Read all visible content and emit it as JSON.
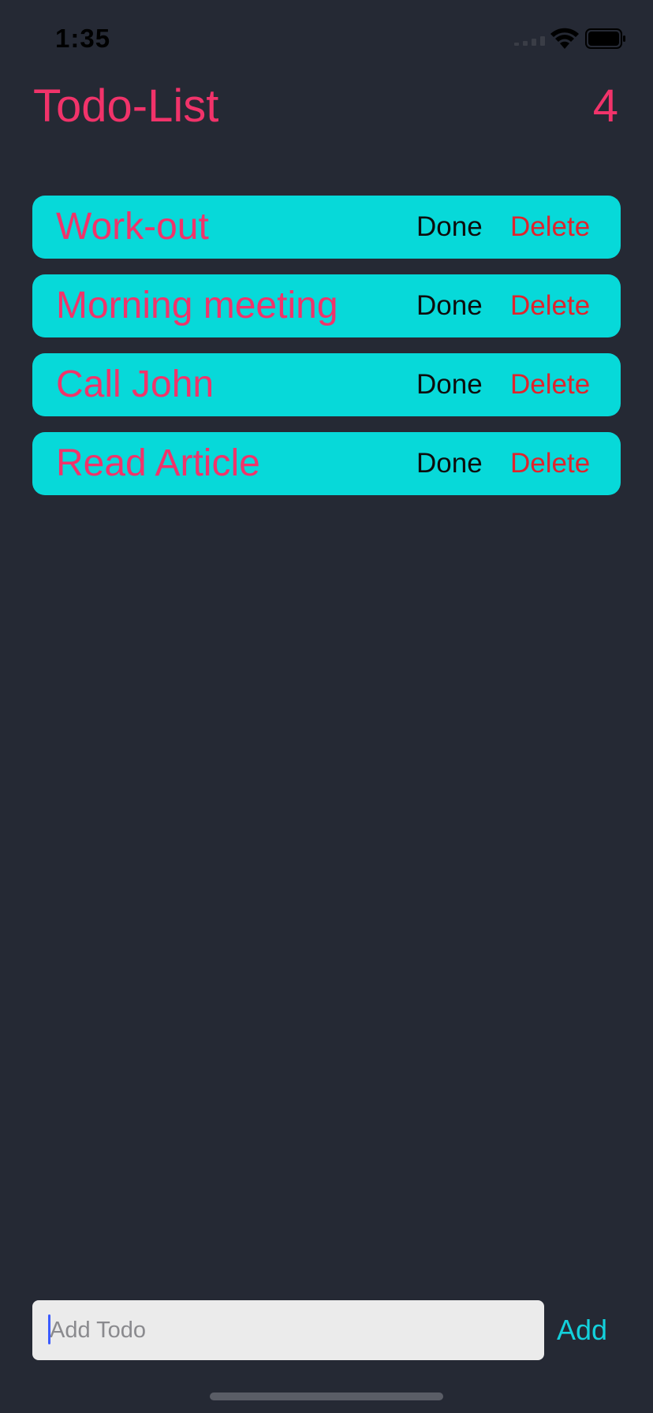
{
  "status_bar": {
    "time": "1:35",
    "icons": [
      "cellular-signal-icon",
      "wifi-icon",
      "battery-icon"
    ]
  },
  "header": {
    "title": "Todo-List",
    "count": "4"
  },
  "todos": [
    {
      "text": "Work-out",
      "done_label": "Done",
      "delete_label": "Delete"
    },
    {
      "text": "Morning meeting",
      "done_label": "Done",
      "delete_label": "Delete"
    },
    {
      "text": "Call John",
      "done_label": "Done",
      "delete_label": "Delete"
    },
    {
      "text": "Read Article",
      "done_label": "Done",
      "delete_label": "Delete"
    }
  ],
  "footer": {
    "input_value": "",
    "input_placeholder": "Add Todo",
    "add_label": "Add"
  },
  "colors": {
    "background": "#252934",
    "accent": "#f1336a",
    "card": "#07d9d9",
    "delete": "#e0242d",
    "add": "#13d1dc"
  }
}
